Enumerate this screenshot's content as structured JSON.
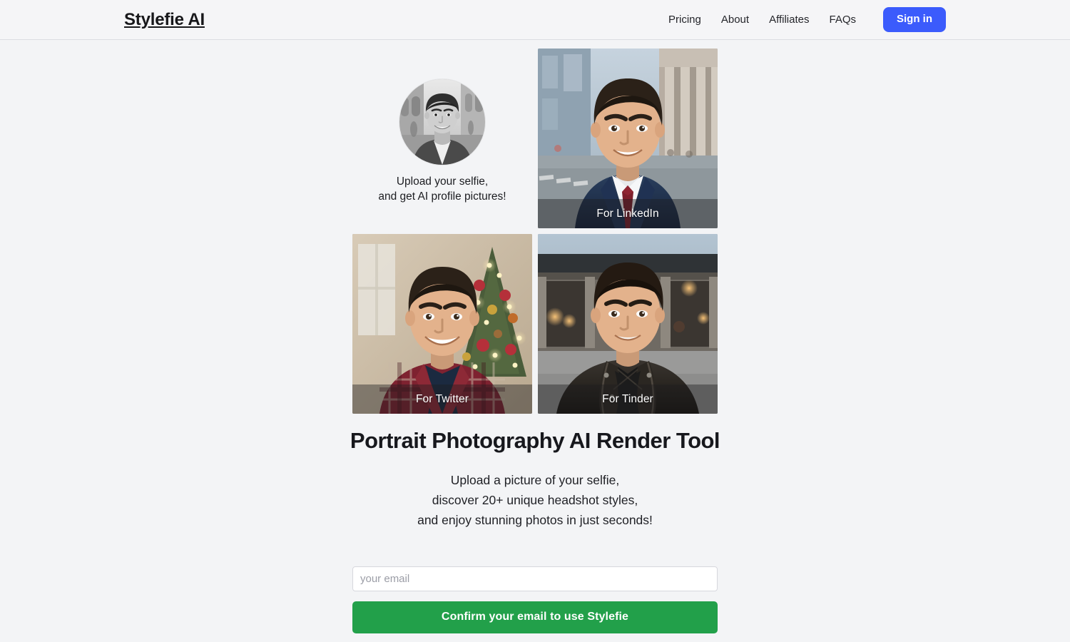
{
  "header": {
    "brand": "Stylefie AI",
    "nav": [
      {
        "label": "Pricing"
      },
      {
        "label": "About"
      },
      {
        "label": "Affiliates"
      },
      {
        "label": "FAQs"
      }
    ],
    "signin_label": "Sign in",
    "accent_blue": "#3b5bfc"
  },
  "hero": {
    "upload": {
      "avatar_alt": "black-and-white selfie of smiling young man on a street",
      "caption": "Upload your selfie,\nand get AI profile pictures!"
    },
    "cards": [
      {
        "label": "For LinkedIn",
        "alt": "young man in navy suit, white shirt and dark red tie on a city street"
      },
      {
        "label": "For Twitter",
        "alt": "young man in red plaid flannel shirt in front of a decorated Christmas tree"
      },
      {
        "label": "For Tinder",
        "alt": "young man in black leather biker jacket in front of a city building at dusk"
      }
    ]
  },
  "main": {
    "headline": "Portrait Photography AI Render Tool",
    "subcopy": "Upload a picture of your selfie,\ndiscover 20+ unique headshot styles,\nand enjoy stunning photos in just seconds!"
  },
  "form": {
    "email_placeholder": "your email",
    "email_value": "",
    "submit_label": "Confirm your email to use Stylefie",
    "accent_green": "#22a04a"
  }
}
